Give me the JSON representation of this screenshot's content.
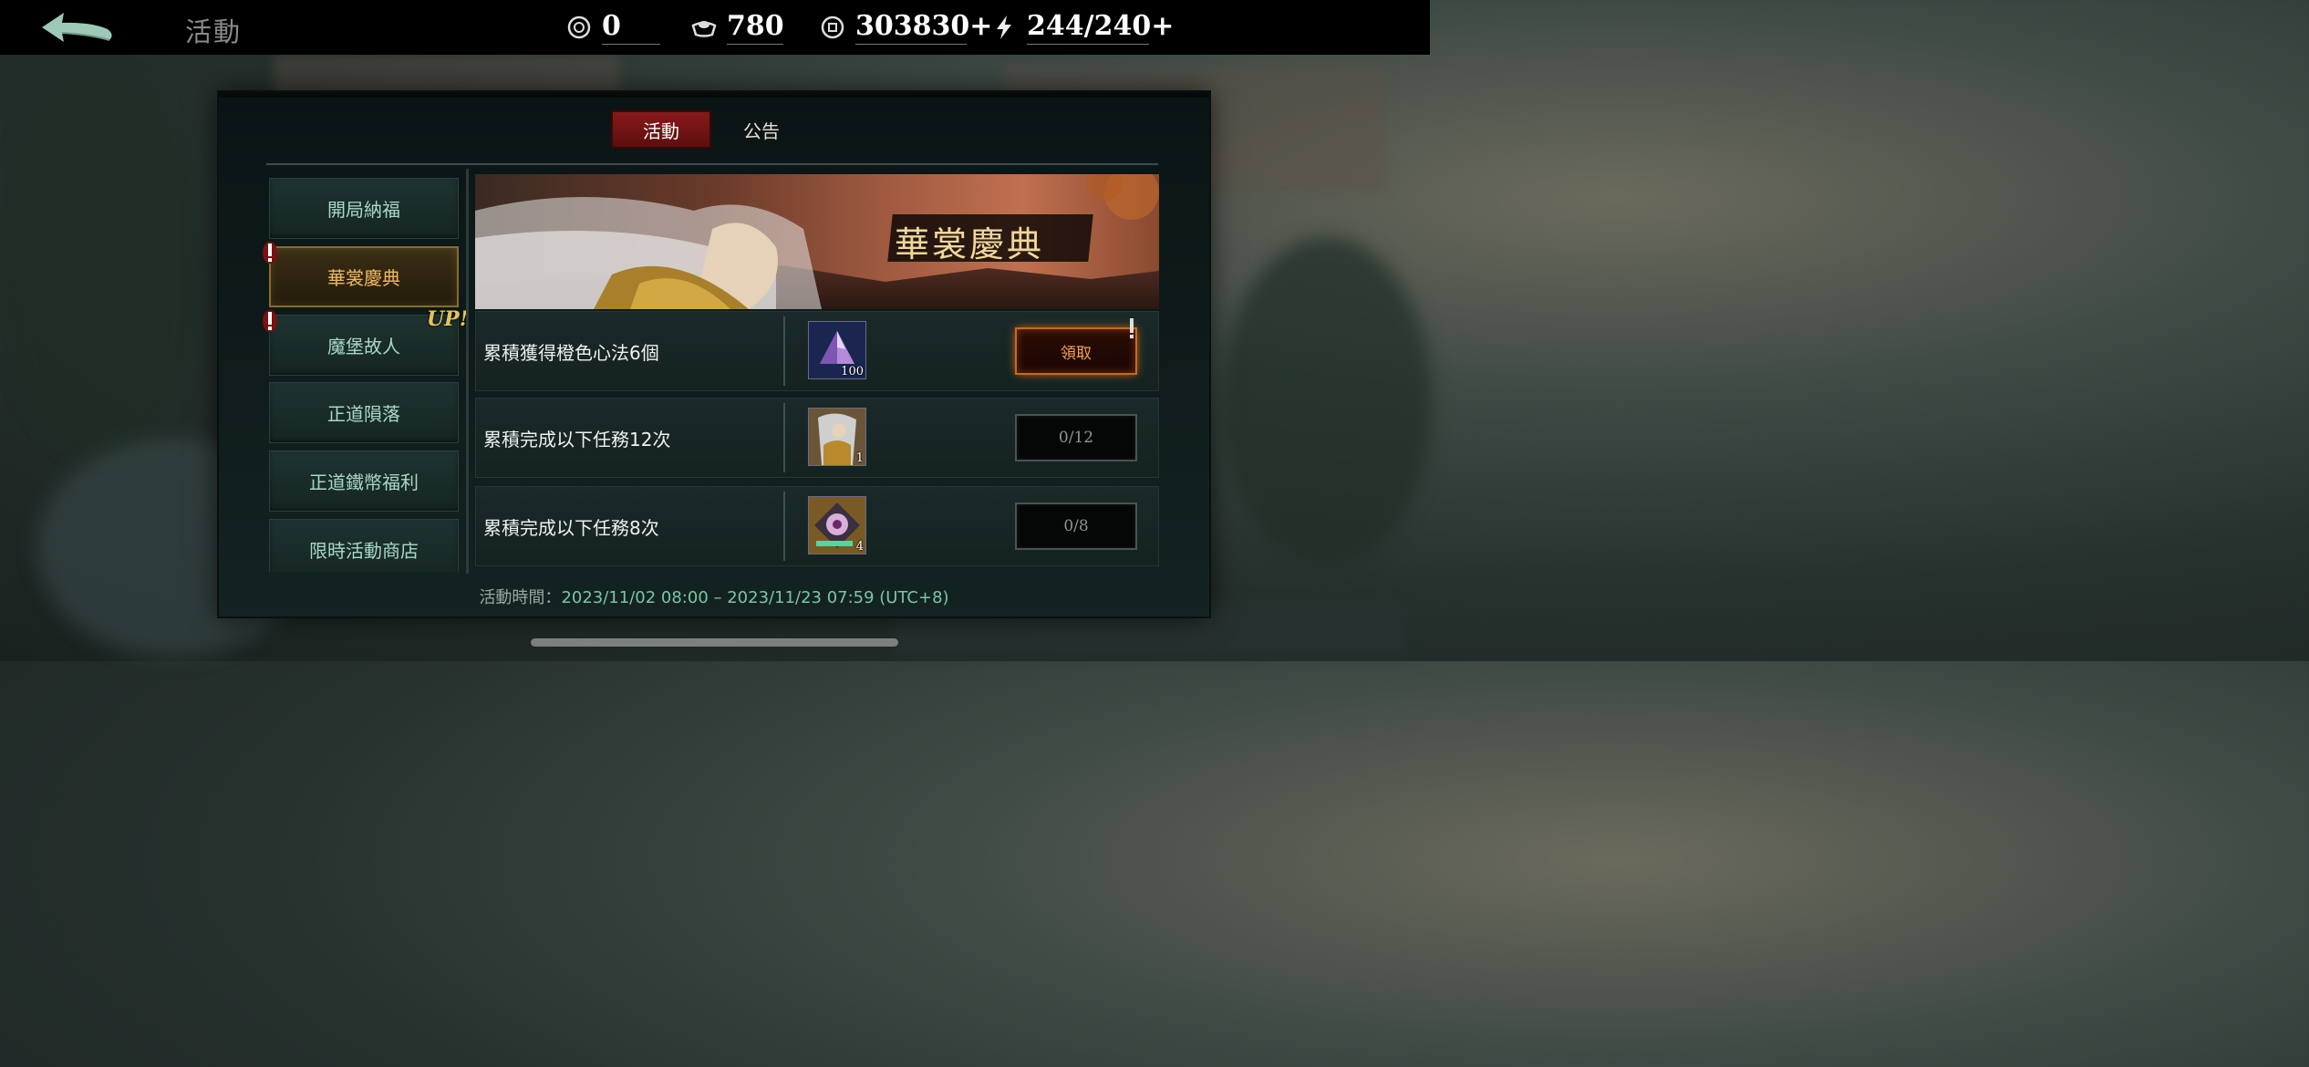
{
  "header": {
    "title": "活動",
    "currencies": [
      {
        "icon": "coin-token-icon",
        "value": "0"
      },
      {
        "icon": "silver-ingot-icon",
        "value": "780"
      },
      {
        "icon": "copper-coin-icon",
        "value": "303830+"
      },
      {
        "icon": "lightning-stamina-icon",
        "value": "244/240+"
      }
    ]
  },
  "tabs": [
    {
      "label": "活動",
      "active": true
    },
    {
      "label": "公告",
      "active": false
    }
  ],
  "sidebar": {
    "items": [
      {
        "label": "開局納福",
        "active": false,
        "alert": false,
        "up": false
      },
      {
        "label": "華裳慶典",
        "active": true,
        "alert": true,
        "up": false
      },
      {
        "label": "魔堡故人",
        "active": false,
        "alert": true,
        "up": true
      },
      {
        "label": "正道隕落",
        "active": false,
        "alert": false,
        "up": false
      },
      {
        "label": "正道鐵幣福利",
        "active": false,
        "alert": false,
        "up": false
      },
      {
        "label": "限時活動商店",
        "active": false,
        "alert": false,
        "up": false
      }
    ],
    "up_badge": "UP!"
  },
  "banner": {
    "title": "華裳慶典"
  },
  "tasks": [
    {
      "text": "累積獲得橙色心法6個",
      "reward_icon": "purple-crystal-icon",
      "reward_count": "100",
      "button": "領取",
      "button_type": "claim"
    },
    {
      "text": "累積完成以下任務12次",
      "reward_icon": "hero-portrait-icon",
      "reward_count": "1",
      "button": "0/12",
      "button_type": "progress"
    },
    {
      "text": "累積完成以下任務8次",
      "reward_icon": "dragon-crest-icon",
      "reward_count": "4",
      "button": "0/8",
      "button_type": "progress"
    }
  ],
  "footer": {
    "label": "活動時間：",
    "value": "2023/11/02 08:00 – 2023/11/23 07:59 (UTC+8)"
  },
  "colors": {
    "accent_red": "#8a1a1a",
    "active_gold": "#f0b860",
    "claim_orange": "#c86a1a",
    "footer_green": "#7cc4a8"
  }
}
